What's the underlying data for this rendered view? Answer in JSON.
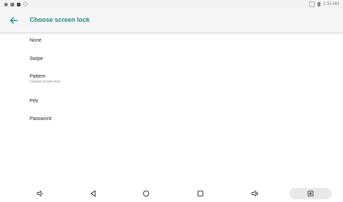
{
  "status_bar": {
    "time": "1:32 AM"
  },
  "toolbar": {
    "title": "Choose screen lock"
  },
  "options": [
    {
      "label": "None"
    },
    {
      "label": "Swipe"
    },
    {
      "label": "Pattern",
      "subtitle": "Current screen lock"
    },
    {
      "label": "PIN"
    },
    {
      "label": "Password"
    }
  ],
  "colors": {
    "accent": "#1a8d84"
  }
}
